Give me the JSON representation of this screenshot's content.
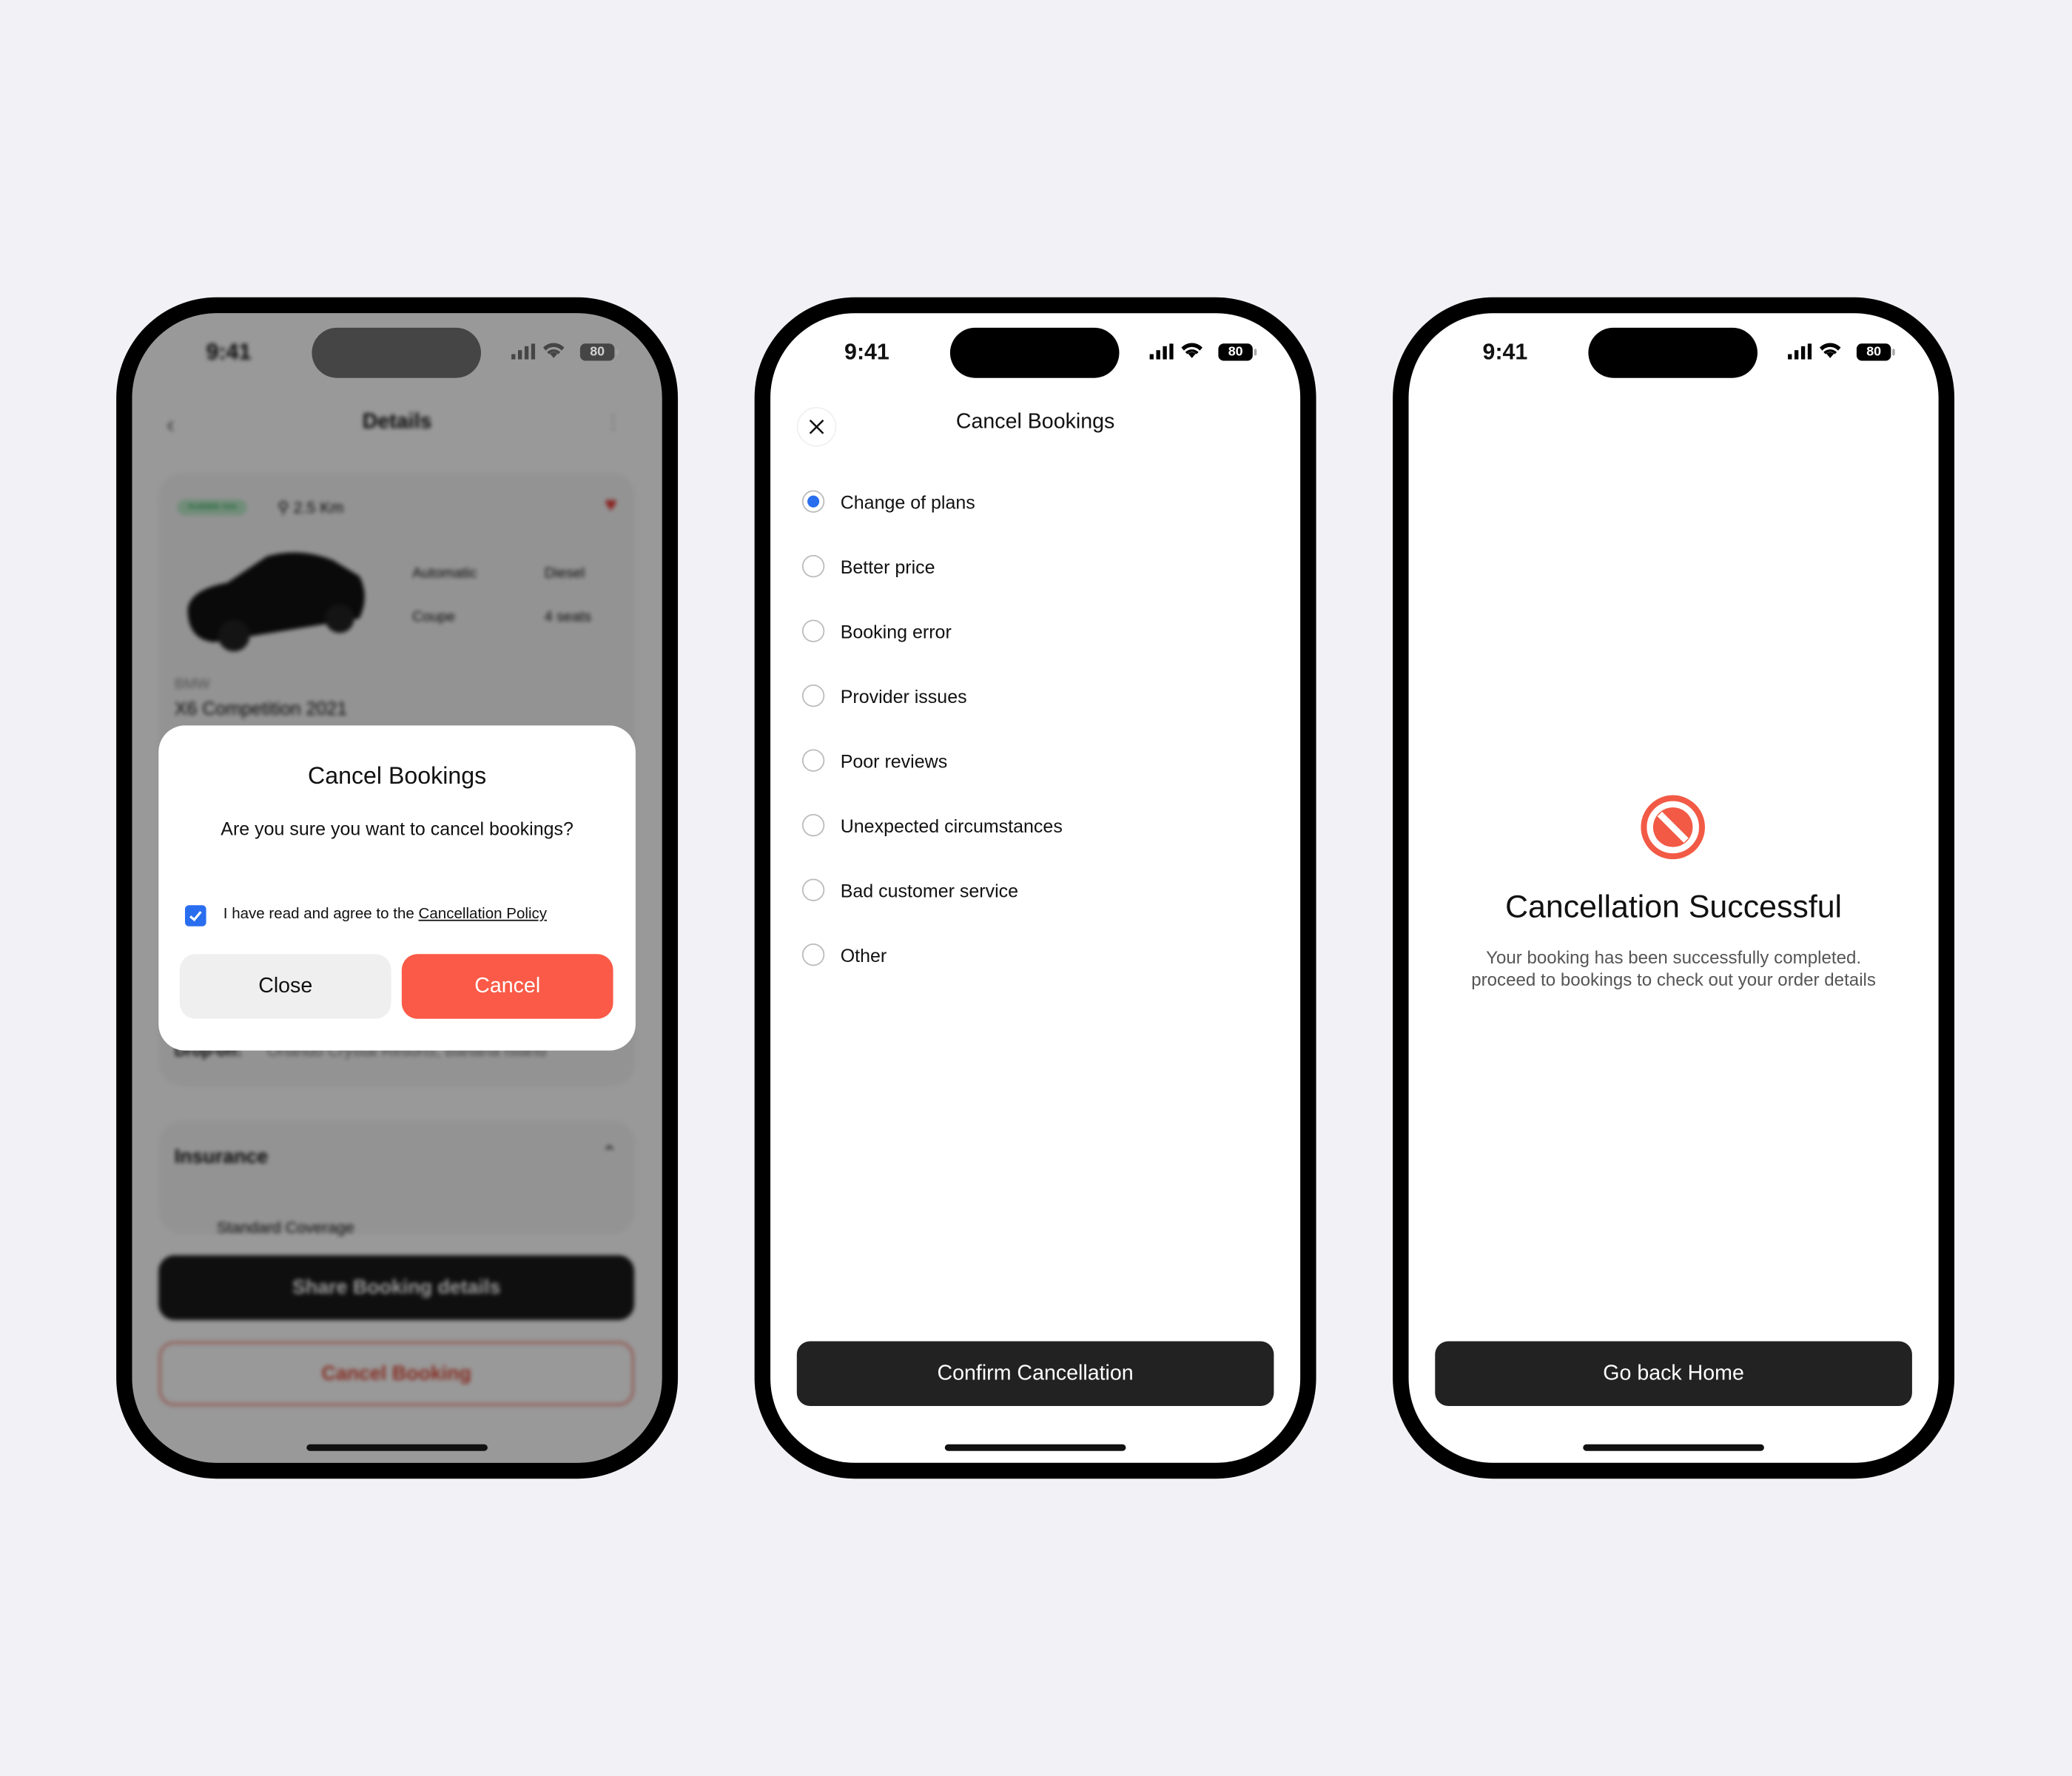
{
  "status_bar": {
    "time": "9:41",
    "battery": "80"
  },
  "details_screen": {
    "title": "Details",
    "badge": "Available now",
    "distance": "2.5 Km",
    "specs": [
      "Automatic",
      "Diesel",
      "Coupe",
      "4 seats"
    ],
    "brand": "BMW",
    "model": "X6 Competition 2021",
    "dropoff_label": "Drop-off:",
    "dropoff_value": "Orlando Crystal Resorts, Banana Island",
    "insurance_title": "Insurance",
    "insurance_option": "Standard Coverage",
    "share_button": "Share Booking details",
    "cancel_booking_button": "Cancel Booking"
  },
  "modal": {
    "title": "Cancel Bookings",
    "question": "Are you sure you want to cancel bookings?",
    "agree_text": "I have read and agree to the ",
    "policy_link": "Cancellation Policy",
    "agree_checked": true,
    "close_button": "Close",
    "cancel_button": "Cancel"
  },
  "reasons_screen": {
    "title": "Cancel Bookings",
    "selected": "Change of plans",
    "options": [
      "Change of plans",
      "Better price",
      "Booking error",
      "Provider issues",
      "Poor reviews",
      "Unexpected circumstances",
      "Bad customer service",
      "Other"
    ],
    "confirm_button": "Confirm Cancellation"
  },
  "success_screen": {
    "icon": "prohibited-icon",
    "title": "Cancellation Successful",
    "line1": "Your booking has been successfully completed.",
    "line2": "proceed to bookings to check out your order details",
    "home_button": "Go back Home"
  },
  "colors": {
    "accent": "#2a6ef0",
    "danger": "#fa5a47",
    "dark_button": "#222222",
    "background": "#f2f2f6"
  }
}
